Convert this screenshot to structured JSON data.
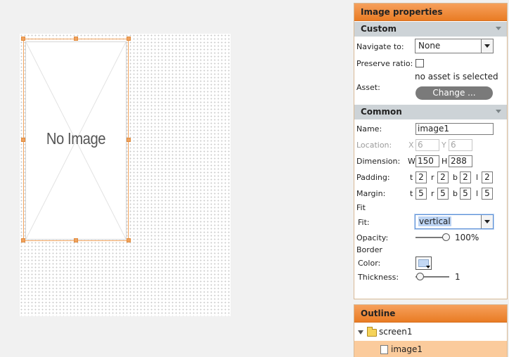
{
  "canvas": {
    "placeholder_text": "No Image"
  },
  "image_properties": {
    "title": "Image properties",
    "custom_section": "Custom",
    "navigate_label": "Navigate to:",
    "navigate_value": "None",
    "preserve_label": "Preserve ratio:",
    "preserve_checked": false,
    "asset_label": "Asset:",
    "asset_status": "no asset is selected",
    "change_button": "Change ...",
    "common_section": "Common",
    "name_label": "Name:",
    "name_value": "image1",
    "location_label": "Location:",
    "x_label": "X",
    "x_value": "6",
    "y_label": "Y",
    "y_value": "6",
    "dimension_label": "Dimension:",
    "w_label": "W",
    "w_value": "150",
    "h_label": "H",
    "h_value": "288",
    "padding_label": "Padding:",
    "padding": {
      "t": "2",
      "r": "2",
      "b": "2",
      "l": "2"
    },
    "margin_label": "Margin:",
    "margin": {
      "t": "5",
      "r": "5",
      "b": "5",
      "l": "5"
    },
    "side_labels": {
      "t": "t",
      "r": "r",
      "b": "b",
      "l": "l"
    },
    "fit_heading": "Fit",
    "fit_label": "Fit:",
    "fit_value": "vertical",
    "opacity_label": "Opacity:",
    "opacity_value": "100%",
    "opacity_fraction": 1.0,
    "border_heading": "Border",
    "color_label": "Color:",
    "border_color": "#c3d8f4",
    "thickness_label": "Thickness:",
    "thickness_value": "1"
  },
  "outline": {
    "title": "Outline",
    "items": [
      {
        "label": "screen1",
        "type": "folder",
        "expanded": true
      },
      {
        "label": "image1",
        "type": "image",
        "selected": true
      }
    ]
  },
  "colors": {
    "accent": "#f0933f",
    "selection_row": "#fbcb9c",
    "section_bg": "#cdd3d7"
  }
}
